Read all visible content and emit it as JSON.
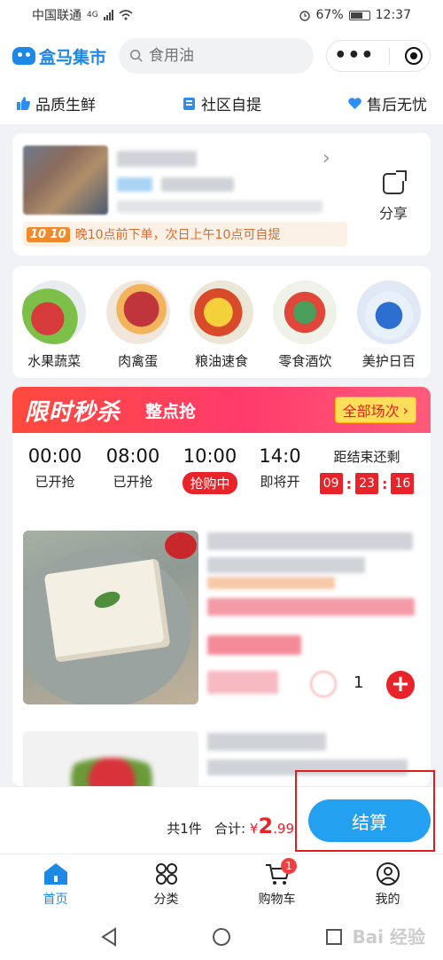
{
  "status_bar": {
    "carrier": "中国联通",
    "network": "4G",
    "battery": "67%",
    "time": "12:37"
  },
  "header": {
    "app_name": "盒马集市",
    "search_placeholder": "食用油"
  },
  "features": [
    "品质生鲜",
    "社区自提",
    "售后无忧"
  ],
  "store": {
    "share_label": "分享",
    "pickup_tag": "10 10",
    "pickup_text": "晚10点前下单，次日上午10点可自提"
  },
  "categories": [
    {
      "label": "水果蔬菜",
      "icon": "fruit-veg-icon"
    },
    {
      "label": "肉禽蛋",
      "icon": "meat-egg-icon"
    },
    {
      "label": "粮油速食",
      "icon": "grain-oil-icon"
    },
    {
      "label": "零食酒饮",
      "icon": "snack-drink-icon"
    },
    {
      "label": "美护日百",
      "icon": "daily-care-icon"
    }
  ],
  "flash_sale": {
    "title": "限时秒杀",
    "subtitle": "整点抢",
    "all_sessions": "全部场次",
    "slots": [
      {
        "time": "00:00",
        "status": "已开抢"
      },
      {
        "time": "08:00",
        "status": "已开抢"
      },
      {
        "time": "10:00",
        "status": "抢购中"
      },
      {
        "time": "14:0",
        "status": "即将开"
      }
    ],
    "countdown_label": "距结束还剩",
    "countdown": [
      "09",
      "23",
      "16"
    ]
  },
  "product": {
    "quantity": "1"
  },
  "checkout": {
    "count_text": "共1件",
    "total_label": "合计:",
    "currency": "¥",
    "amount_int": "2",
    "amount_dec": ".99",
    "pay_label": "结算"
  },
  "tabbar": {
    "home": "首页",
    "category": "分类",
    "cart": "购物车",
    "cart_badge": "1",
    "mine": "我的"
  },
  "watermark": "Bai 经验"
}
